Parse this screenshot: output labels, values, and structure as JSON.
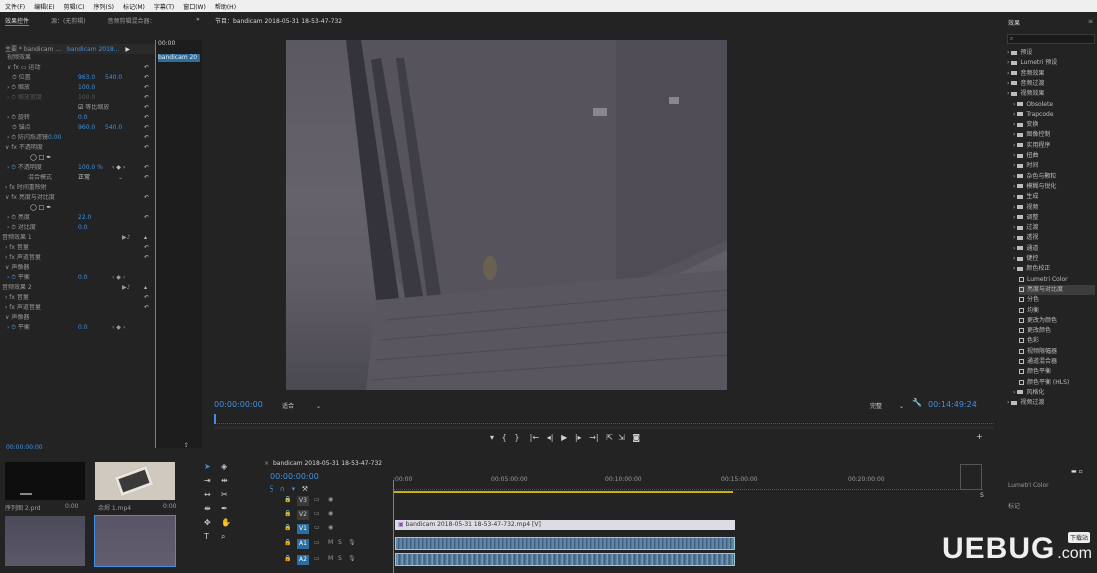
{
  "menu": [
    "文件(F)",
    "编辑(E)",
    "剪辑(C)",
    "序列(S)",
    "标记(M)",
    "字幕(T)",
    "窗口(W)",
    "帮助(H)"
  ],
  "effect_controls": {
    "tabs": [
      "效果控件",
      "源：(无剪辑)",
      "音频剪辑混合器："
    ],
    "tab_more": "»",
    "master_label": "主要 * bandicam ...",
    "clip_label": "bandicam 2018...",
    "mini_timecode": "00:00",
    "mini_clip": "bandicam 20",
    "video_effects": "视频效果",
    "motion": "运动",
    "position_label": "位置",
    "position_x": "963.0",
    "position_y": "540.0",
    "scale_label": "缩放",
    "scale_value": "100.0",
    "scale_width_label": "缩放宽度",
    "scale_width_value": "100.0",
    "uniform_scale_label": "等比缩放",
    "rotation_label": "旋转",
    "rotation_value": "0.0",
    "anchor_label": "锚点",
    "anchor_x": "960.0",
    "anchor_y": "540.0",
    "flicker_label": "防闪烁滤镜",
    "flicker_value": "0.00",
    "opacity_group": "不透明度",
    "opacity_label": "不透明度",
    "opacity_value": "100.0 %",
    "blend_label": "混合模式",
    "blend_value": "正常",
    "time_remap": "时间重映射",
    "brightness_group": "亮度与对比度",
    "brightness_label": "亮度",
    "brightness_value": "22.0",
    "contrast_label": "对比度",
    "contrast_value": "0.0",
    "audio1_label": "音频效果 1",
    "volume_label": "音量",
    "channel_volume_label": "声道音量",
    "panner_label": "声像器",
    "balance_label": "平衡",
    "balance_value": "0.0",
    "audio2_label": "音频效果 2",
    "volume2_label": "音量",
    "channel_volume2_label": "声道音量",
    "panner2_label": "声像器",
    "balance2_label": "平衡",
    "balance2_value": "0.0",
    "bottom_timecode": "00:00:00:00"
  },
  "program": {
    "title": "节目：bandicam 2018-05-31 18-53-47-732",
    "timecode": "00:00:00:00",
    "fit": "适合",
    "quality": "完整",
    "duration": "00:14:49:24"
  },
  "project": {
    "items": [
      {
        "name": "序列图 2.prd",
        "dur": "0:00"
      },
      {
        "name": "余烬 1.mp4",
        "dur": "0:00"
      }
    ]
  },
  "timeline": {
    "title": "bandicam 2018-05-31 18-53-47-732",
    "timecode": "00:00:00:00",
    "ruler": [
      ":00:00",
      "00:05:00:00",
      "00:10:00:00",
      "00:15:00:00",
      "00:20:00:00"
    ],
    "video_tracks": [
      "V3",
      "V2",
      "V1"
    ],
    "audio_tracks": [
      "A1",
      "A2"
    ],
    "clip_label": "bandicam 2018-05-31 18-53-47-732.mp4 [V]",
    "meter_label": "S"
  },
  "effects_panel": {
    "title": "效果",
    "tree": [
      {
        "label": "预设",
        "type": "folder",
        "indent": 0
      },
      {
        "label": "Lumetri 预设",
        "type": "folder",
        "indent": 0
      },
      {
        "label": "音频效果",
        "type": "folder",
        "indent": 0
      },
      {
        "label": "音频过渡",
        "type": "folder",
        "indent": 0
      },
      {
        "label": "视频效果",
        "type": "folder",
        "indent": 0
      },
      {
        "label": "Obsolete",
        "type": "folder",
        "indent": 1
      },
      {
        "label": "Trapcode",
        "type": "folder",
        "indent": 1
      },
      {
        "label": "变换",
        "type": "folder",
        "indent": 1
      },
      {
        "label": "图像控制",
        "type": "folder",
        "indent": 1
      },
      {
        "label": "实用程序",
        "type": "folder",
        "indent": 1
      },
      {
        "label": "扭曲",
        "type": "folder",
        "indent": 1
      },
      {
        "label": "时间",
        "type": "folder",
        "indent": 1
      },
      {
        "label": "杂色与颗粒",
        "type": "folder",
        "indent": 1
      },
      {
        "label": "模糊与锐化",
        "type": "folder",
        "indent": 1
      },
      {
        "label": "生成",
        "type": "folder",
        "indent": 1
      },
      {
        "label": "视频",
        "type": "folder",
        "indent": 1
      },
      {
        "label": "调整",
        "type": "folder",
        "indent": 1
      },
      {
        "label": "过渡",
        "type": "folder",
        "indent": 1
      },
      {
        "label": "透视",
        "type": "folder",
        "indent": 1
      },
      {
        "label": "通道",
        "type": "folder",
        "indent": 1
      },
      {
        "label": "键控",
        "type": "folder",
        "indent": 1
      },
      {
        "label": "颜色校正",
        "type": "folder",
        "indent": 1
      },
      {
        "label": "Lumetri Color",
        "type": "fx",
        "indent": 2
      },
      {
        "label": "亮度与对比度",
        "type": "fx",
        "indent": 2,
        "selected": true
      },
      {
        "label": "分色",
        "type": "fx",
        "indent": 2
      },
      {
        "label": "均衡",
        "type": "fx",
        "indent": 2
      },
      {
        "label": "更改为颜色",
        "type": "fx",
        "indent": 2
      },
      {
        "label": "更改颜色",
        "type": "fx",
        "indent": 2
      },
      {
        "label": "色彩",
        "type": "fx",
        "indent": 2
      },
      {
        "label": "视频限幅器",
        "type": "fx",
        "indent": 2
      },
      {
        "label": "通道混合器",
        "type": "fx",
        "indent": 2
      },
      {
        "label": "颜色平衡",
        "type": "fx",
        "indent": 2
      },
      {
        "label": "颜色平衡 (HLS)",
        "type": "fx",
        "indent": 2
      },
      {
        "label": "风格化",
        "type": "folder",
        "indent": 1
      },
      {
        "label": "视频过渡",
        "type": "folder",
        "indent": 0
      }
    ],
    "lumetri_label": "Lumetri Color",
    "markers_label": "标记"
  },
  "watermark": {
    "text": "UEBUG",
    "sub": "下载站",
    "com": ".com"
  }
}
